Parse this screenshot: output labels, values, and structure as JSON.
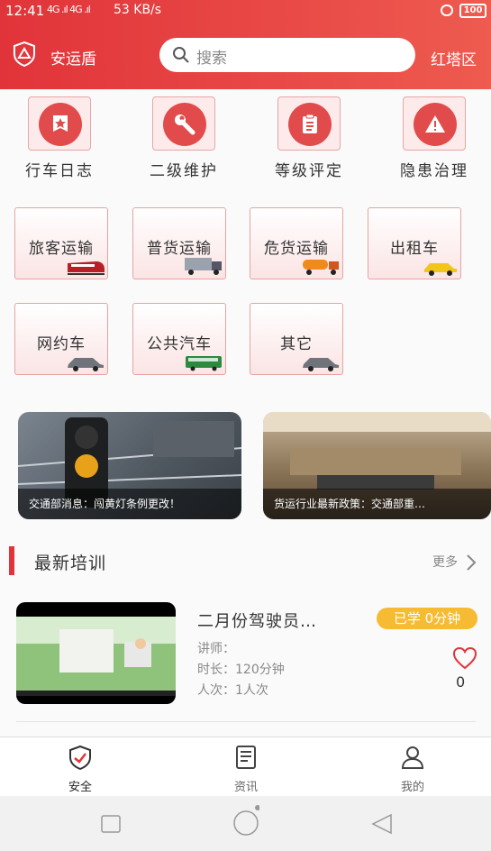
{
  "status_bar": {
    "time": "12:41",
    "signal": "4G .ıl 4G .ıl",
    "speed": "53 KB/s",
    "battery": "100"
  },
  "header": {
    "app_title": "安运盾",
    "search_placeholder": "搜索",
    "region": "红塔区"
  },
  "features": [
    {
      "label": "行车日志",
      "icon": "star-badge-icon"
    },
    {
      "label": "二级维护",
      "icon": "wrench-icon"
    },
    {
      "label": "等级评定",
      "icon": "clipboard-icon"
    },
    {
      "label": "隐患治理",
      "icon": "warning-icon"
    }
  ],
  "categories": [
    {
      "label": "旅客运输",
      "icon": "train-icon"
    },
    {
      "label": "普货运输",
      "icon": "truck-icon"
    },
    {
      "label": "危货运输",
      "icon": "tanker-icon"
    },
    {
      "label": "出租车",
      "icon": "taxi-icon"
    },
    {
      "label": "网约车",
      "icon": "car-icon"
    },
    {
      "label": "公共汽车",
      "icon": "bus-icon"
    },
    {
      "label": "其它",
      "icon": "car-icon"
    }
  ],
  "news": [
    {
      "caption": "交通部消息：闯黄灯条例更改！"
    },
    {
      "caption": "货运行业最新政策：交通部重…"
    }
  ],
  "training_section": {
    "title": "最新培训",
    "more": "更多"
  },
  "training": {
    "title": "二月份驾驶员…",
    "badge": "已学 0分钟",
    "lecturer": "讲师：",
    "duration": "时长：120分钟",
    "visits": "人次：1人次",
    "likes": "0"
  },
  "tabs": [
    {
      "label": "安全",
      "icon": "shield-check-icon",
      "active": true
    },
    {
      "label": "资讯",
      "icon": "news-icon",
      "active": false
    },
    {
      "label": "我的",
      "icon": "user-icon",
      "active": false
    }
  ],
  "colors": {
    "primary": "#e1343a",
    "badge": "#f6bb32",
    "card_border": "#e8a3a3"
  }
}
